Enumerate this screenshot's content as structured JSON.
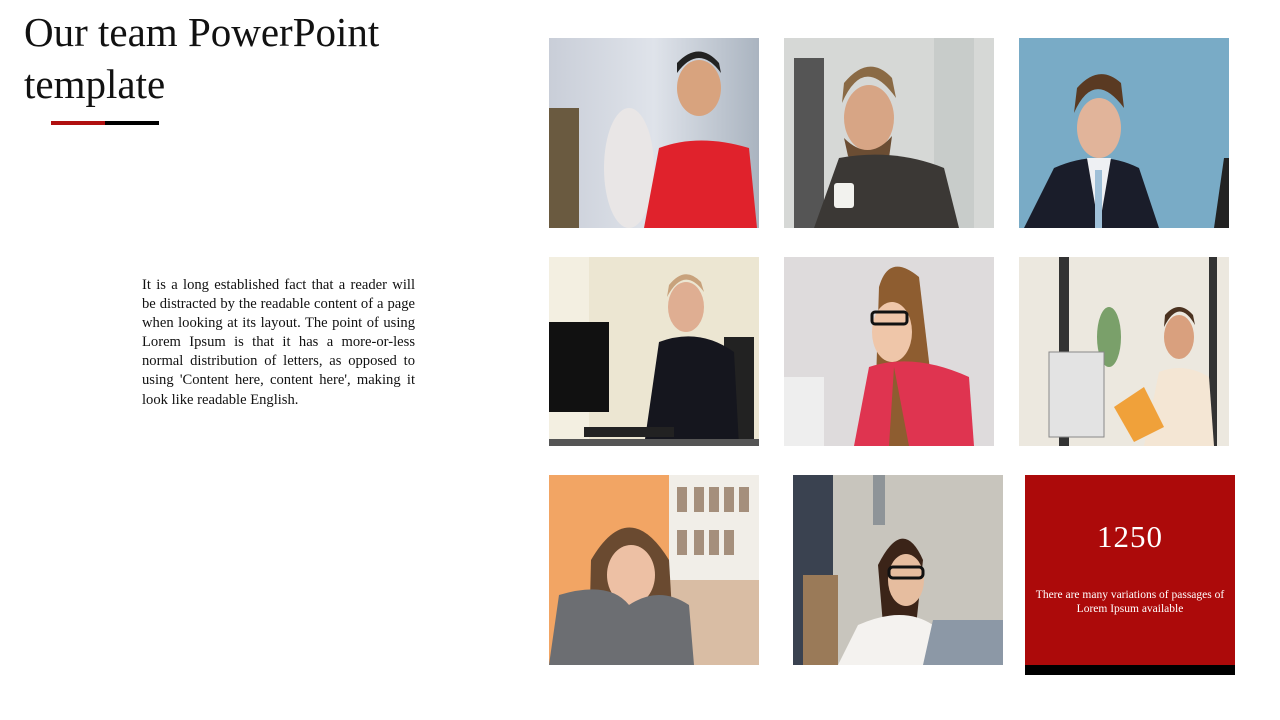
{
  "slide": {
    "title": "Our team PowerPoint template",
    "accent_colors": {
      "red": "#b01010",
      "black": "#000000",
      "stat_background": "#ac0a0a"
    },
    "body_text": "It is a long established fact that a reader will be distracted by the readable content of a page when looking at its layout. The point of using Lorem Ipsum is that it has a more-or-less normal distribution of letters, as opposed to using 'Content here, content here', making it look like readable English.",
    "team_photos": [
      {
        "description": "Smiling man with glasses in red t-shirt in office"
      },
      {
        "description": "Bearded man in blazer holding coffee cup"
      },
      {
        "description": "Man in dark suit against blue background"
      },
      {
        "description": "Man in black shirt thinking at computer desk"
      },
      {
        "description": "Woman with glasses in pink blazer smiling"
      },
      {
        "description": "Man holding a yellow book by office window"
      },
      {
        "description": "Woman with long hair looking down by window"
      },
      {
        "description": "Woman with glasses and braid at laptop"
      }
    ],
    "stat": {
      "number": "1250",
      "description": "There are many variations of passages of Lorem Ipsum available"
    }
  }
}
